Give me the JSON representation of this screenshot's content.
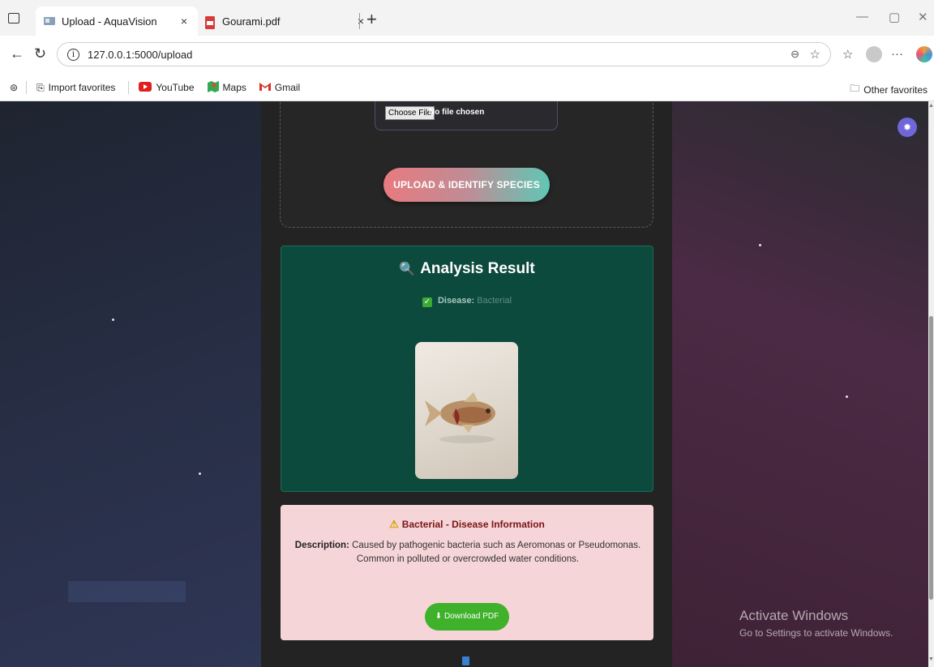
{
  "browser": {
    "tabs": [
      {
        "title": "Upload - AquaVision",
        "active": true
      },
      {
        "title": "Gourami.pdf",
        "active": false
      }
    ],
    "url": "127.0.0.1:5000/upload",
    "bookmarks": [
      {
        "label": "Import favorites",
        "icon": "import-icon"
      },
      {
        "label": "YouTube",
        "icon": "youtube-icon"
      },
      {
        "label": "Maps",
        "icon": "maps-icon"
      },
      {
        "label": "Gmail",
        "icon": "gmail-icon"
      }
    ],
    "other_favorites": "Other favorites"
  },
  "upload": {
    "choose_file_label": "Choose File",
    "no_file_text": "No file chosen",
    "submit_label": "UPLOAD & IDENTIFY SPECIES"
  },
  "result": {
    "title": "Analysis Result",
    "disease_label": "Disease:",
    "disease_value": "Bacterial"
  },
  "info": {
    "title": "Bacterial - Disease Information",
    "description_label": "Description:",
    "description_text": "Caused by pathogenic bacteria such as Aeromonas or Pseudomonas. Common in polluted or overcrowded water conditions.",
    "download_label": "Download PDF"
  },
  "watermark": {
    "line1": "Activate Windows",
    "line2": "Go to Settings to activate Windows."
  },
  "colors": {
    "result_bg": "#0c4a3d",
    "info_bg": "#f6d5d8",
    "download_green": "#3fb12a",
    "settings_purple": "#6f66d9"
  }
}
